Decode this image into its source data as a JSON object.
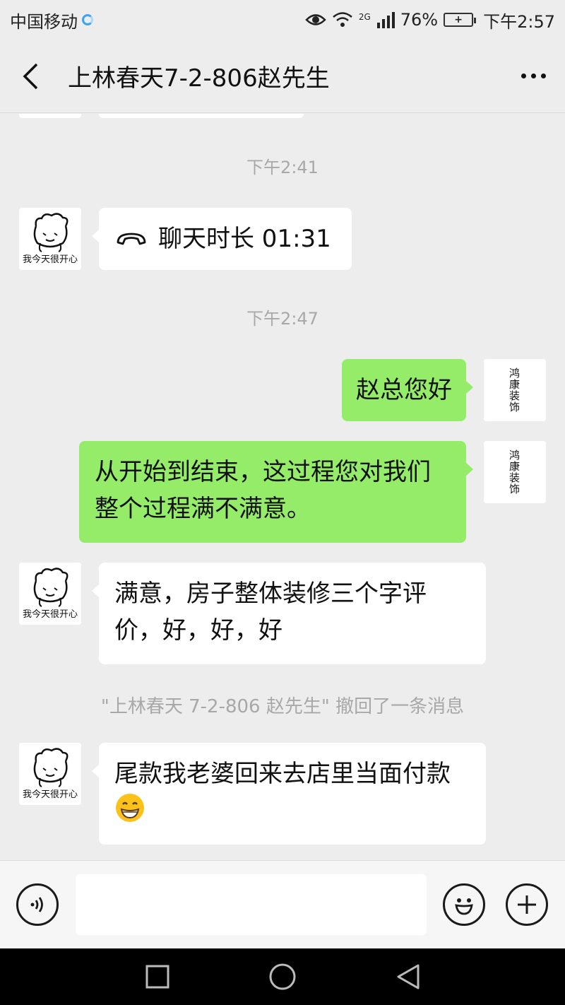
{
  "status_bar": {
    "carrier": "中国移动",
    "network": "2G",
    "battery": "76%",
    "time": "下午2:57"
  },
  "header": {
    "back_icon": "chevron-left-icon",
    "title": "上林春天7-2-806赵先生",
    "more_icon": "more-dots-icon"
  },
  "chat": {
    "timestamps": [
      "下午2:41",
      "下午2:47"
    ],
    "call_message": {
      "icon": "phone-hangup-icon",
      "text": "聊天时长 01:31"
    },
    "outgoing_1": "赵总您好",
    "outgoing_2": "从开始到结束，这过程您对我们整个过程满不满意。",
    "incoming_reply": "满意，房子整体装修三个字评价，好，好，好",
    "recall_notice": "\"上林春天 7-2-806 赵先生\" 撤回了一条消息",
    "incoming_last": "尾款我老婆回来去店里当面付款",
    "incoming_last_emoji": "grinning-face-emoji",
    "other_avatar_caption": "我今天很开心",
    "self_avatar_caption": "鸿康装饰"
  },
  "input_bar": {
    "voice_icon": "voice-icon",
    "text_value": "",
    "emoji_icon": "smiley-icon",
    "plus_icon": "plus-icon"
  },
  "nav_bar": {
    "icons": [
      "recent-apps-icon",
      "home-icon",
      "back-icon"
    ]
  },
  "colors": {
    "background": "#ededed",
    "outgoing_bubble": "#95ec69",
    "incoming_bubble": "#ffffff",
    "meta_text": "#a8a8a8"
  }
}
